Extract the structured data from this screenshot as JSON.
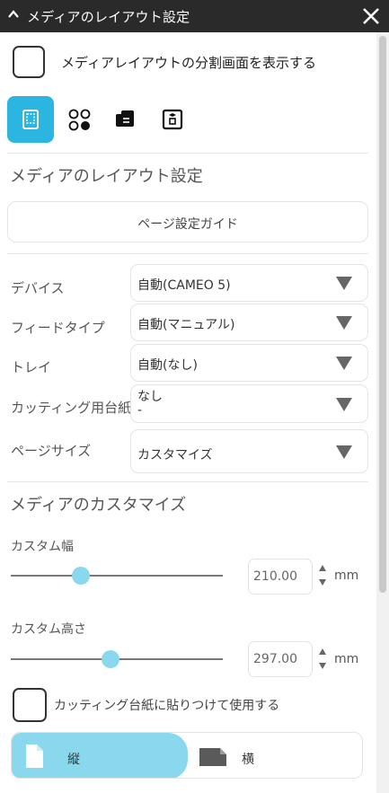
{
  "titlebar": {
    "title": "メディアのレイアウト設定"
  },
  "split_view": {
    "label": "メディアレイアウトの分割画面を表示する",
    "checked": false
  },
  "tabs": [
    {
      "icon": "page-setup-icon",
      "active": true
    },
    {
      "icon": "dots-grid-icon",
      "active": false
    },
    {
      "icon": "roll-media-icon",
      "active": false
    },
    {
      "icon": "registration-marks-icon",
      "active": false
    }
  ],
  "section_media_layout": {
    "heading": "メディアのレイアウト設定",
    "guide_button": "ページ設定ガイド"
  },
  "settings": {
    "device": {
      "label": "デバイス",
      "value": "自動(CAMEO 5)"
    },
    "feed_type": {
      "label": "フィードタイプ",
      "value": "自動(マニュアル)"
    },
    "tray": {
      "label": "トレイ",
      "value": "自動(なし)"
    },
    "cutting_mat": {
      "label": "カッティング用台紙",
      "value": "なし",
      "value2": "-"
    },
    "page_size": {
      "label": "ページサイズ",
      "value": "カスタマイズ"
    }
  },
  "section_custom": {
    "heading": "メディアのカスタマイズ"
  },
  "custom_width": {
    "label": "カスタム幅",
    "value": "210.00",
    "unit": "mm",
    "slider_fraction": 0.33
  },
  "custom_height": {
    "label": "カスタム高さ",
    "value": "297.00",
    "unit": "mm",
    "slider_fraction": 0.47
  },
  "mat_option": {
    "label": "カッティング台紙に貼りつけて使用する",
    "checked": false
  },
  "orientation": {
    "portrait_label": "縦",
    "landscape_label": "横",
    "selected": "portrait"
  },
  "colors": {
    "accent": "#2cb5e0",
    "accent_light": "#8ad8ee",
    "titlebar": "#2a2a2a"
  }
}
